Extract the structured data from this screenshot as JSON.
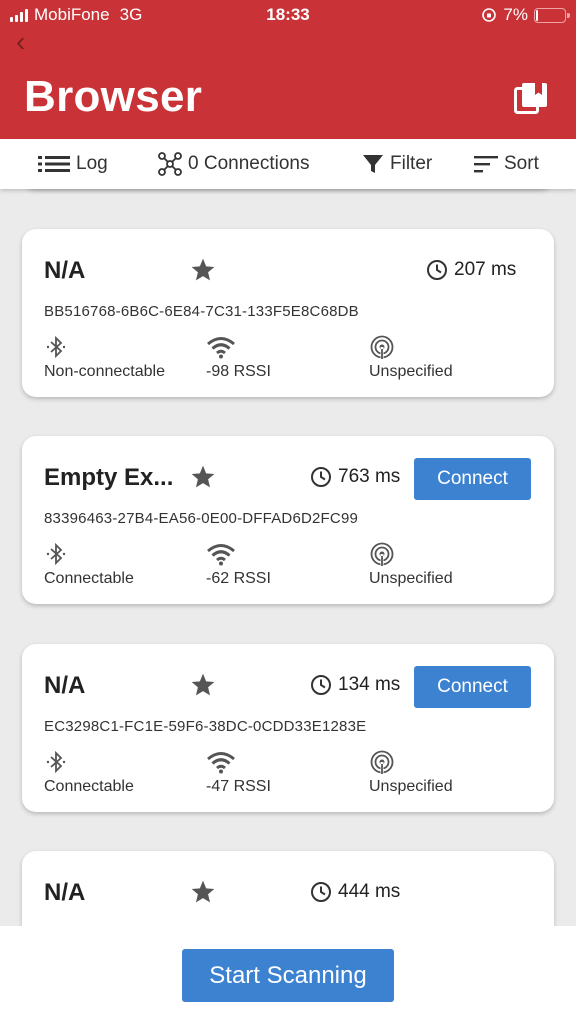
{
  "status_bar": {
    "carrier": "MobiFone",
    "network": "3G",
    "time": "18:33",
    "battery": "7%",
    "battery_level": 0.07
  },
  "header": {
    "title": "Browser"
  },
  "toolbar": {
    "log": "Log",
    "connections": "0 Connections",
    "filter": "Filter",
    "sort": "Sort"
  },
  "devices": [
    {
      "name": "N/A",
      "time": "207 ms",
      "uuid": "BB516768-6B6C-6E84-7C31-133F5E8C68DB",
      "connectable": "Non-connectable",
      "rssi": "-98 RSSI",
      "type": "Unspecified",
      "connect_label": ""
    },
    {
      "name": "Empty Ex...",
      "time": "763 ms",
      "uuid": "83396463-27B4-EA56-0E00-DFFAD6D2FC99",
      "connectable": "Connectable",
      "rssi": "-62 RSSI",
      "type": "Unspecified",
      "connect_label": "Connect"
    },
    {
      "name": "N/A",
      "time": "134 ms",
      "uuid": "EC3298C1-FC1E-59F6-38DC-0CDD33E1283E",
      "connectable": "Connectable",
      "rssi": "-47 RSSI",
      "type": "Unspecified",
      "connect_label": "Connect"
    },
    {
      "name": "N/A",
      "time": "444 ms"
    }
  ],
  "footer": {
    "start_scanning": "Start Scanning"
  },
  "colors": {
    "header": "#c93236",
    "accent": "#3c82d0",
    "background": "#ebebeb"
  }
}
